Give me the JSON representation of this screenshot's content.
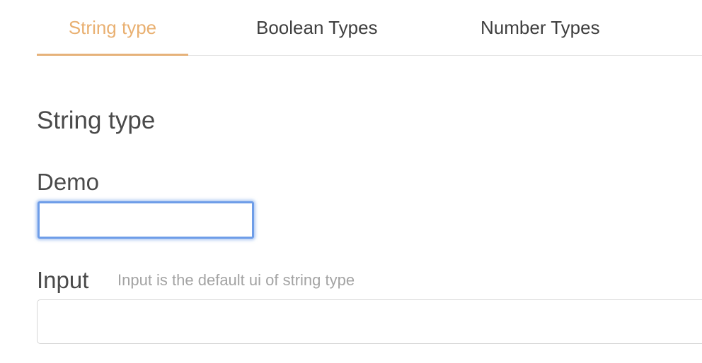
{
  "tabs": [
    {
      "label": "String type",
      "active": true
    },
    {
      "label": "Boolean Types",
      "active": false
    },
    {
      "label": "Number Types",
      "active": false
    }
  ],
  "content": {
    "title": "String type",
    "demo": {
      "label": "Demo",
      "value": ""
    },
    "input_field": {
      "label": "Input",
      "hint": "Input is the default ui of string type",
      "value": ""
    }
  },
  "colors": {
    "accent": "#e9b071",
    "focus_ring": "#6e9de8",
    "text": "#4a4a4a",
    "hint": "#a3a3a3",
    "border": "#d6d6d6"
  }
}
